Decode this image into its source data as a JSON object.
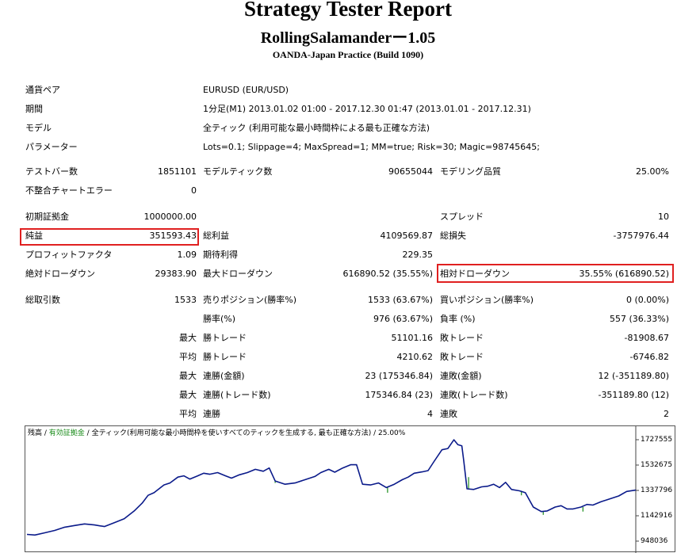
{
  "header": {
    "title": "Strategy Tester Report",
    "subtitle": "RollingSalamanderー1.05",
    "build": "OANDA-Japan Practice (Build 1090)"
  },
  "settings": {
    "symbol_label": "通貨ペア",
    "symbol_value": "EURUSD (EUR/USD)",
    "period_label": "期間",
    "period_value": "1分足(M1) 2013.01.02 01:00 - 2017.12.30 01:47 (2013.01.01 - 2017.12.31)",
    "model_label": "モデル",
    "model_value": "全ティック (利用可能な最小時間枠による最も正確な方法)",
    "params_label": "パラメーター",
    "params_value": "Lots=0.1; Slippage=4; MaxSpread=1; MM=true; Risk=30; Magic=98745645;"
  },
  "quality": {
    "bars_label": "テストバー数",
    "bars_value": "1851101",
    "ticks_label": "モデルティック数",
    "ticks_value": "90655044",
    "quality_label": "モデリング品質",
    "quality_value": "25.00%",
    "errors_label": "不整合チャートエラー",
    "errors_value": "0"
  },
  "results": {
    "deposit_label": "初期証拠金",
    "deposit_value": "1000000.00",
    "spread_label": "スプレッド",
    "spread_value": "10",
    "net_label": "純益",
    "net_value": "351593.43",
    "gross_profit_label": "総利益",
    "gross_profit_value": "4109569.87",
    "gross_loss_label": "総損失",
    "gross_loss_value": "-3757976.44",
    "pf_label": "プロフィットファクタ",
    "pf_value": "1.09",
    "expected_label": "期待利得",
    "expected_value": "229.35",
    "abs_dd_label": "絶対ドローダウン",
    "abs_dd_value": "29383.90",
    "max_dd_label": "最大ドローダウン",
    "max_dd_value": "616890.52 (35.55%)",
    "rel_dd_label": "相対ドローダウン",
    "rel_dd_value": "35.55% (616890.52)"
  },
  "trades": {
    "total_label": "総取引数",
    "total_value": "1533",
    "short_label": "売りポジション(勝率%)",
    "short_value": "1533 (63.67%)",
    "long_label": "買いポジション(勝率%)",
    "long_value": "0 (0.00%)",
    "win_label": "勝率(%)",
    "win_value": "976 (63.67%)",
    "loss_label": "負率 (%)",
    "loss_value": "557 (36.33%)",
    "largest_prefix": "最大",
    "largest_win_label": "勝トレード",
    "largest_win_value": "51101.16",
    "largest_loss_label": "敗トレード",
    "largest_loss_value": "-81908.67",
    "average_prefix": "平均",
    "average_win_label": "勝トレード",
    "average_win_value": "4210.62",
    "average_loss_label": "敗トレード",
    "average_loss_value": "-6746.82",
    "max_money_prefix": "最大",
    "max_consec_win_money_label": "連勝(金額)",
    "max_consec_win_money_value": "23 (175346.84)",
    "max_consec_loss_money_label": "連敗(金額)",
    "max_consec_loss_money_value": "12 (-351189.80)",
    "max_count_prefix": "最大",
    "max_consec_win_count_label": "連勝(トレード数)",
    "max_consec_win_count_value": "175346.84 (23)",
    "max_consec_loss_count_label": "連敗(トレード数)",
    "max_consec_loss_count_value": "-351189.80 (12)",
    "avg_consec_prefix": "平均",
    "avg_consec_win_label": "連勝",
    "avg_consec_win_value": "4",
    "avg_consec_loss_label": "連敗",
    "avg_consec_loss_value": "2"
  },
  "chart_data": {
    "type": "line",
    "legend": {
      "balance": "残高",
      "sep1": " / ",
      "equity": "有効証拠金",
      "sep2": " / ",
      "model": "全ティック(利用可能な最小時間枠を使いすべてのティックを生成する, 最も正確な方法)",
      "sep3": " / ",
      "quality": "25.00%"
    },
    "y_ticks": [
      "1727555",
      "1532675",
      "1337796",
      "1142916",
      "948036"
    ],
    "ylim": [
      948036,
      1727555
    ],
    "xlim": [
      0,
      1533
    ],
    "balance_color": "#0a1a8a",
    "equity_color": "#1a8c1a",
    "balance": [
      [
        0,
        1000000
      ],
      [
        20,
        995000
      ],
      [
        45,
        1012000
      ],
      [
        70,
        1030000
      ],
      [
        95,
        1055000
      ],
      [
        120,
        1068000
      ],
      [
        145,
        1080000
      ],
      [
        170,
        1072000
      ],
      [
        195,
        1060000
      ],
      [
        220,
        1090000
      ],
      [
        245,
        1120000
      ],
      [
        270,
        1180000
      ],
      [
        290,
        1240000
      ],
      [
        305,
        1300000
      ],
      [
        320,
        1320000
      ],
      [
        345,
        1380000
      ],
      [
        360,
        1395000
      ],
      [
        380,
        1440000
      ],
      [
        395,
        1450000
      ],
      [
        410,
        1425000
      ],
      [
        430,
        1450000
      ],
      [
        445,
        1470000
      ],
      [
        460,
        1462000
      ],
      [
        480,
        1475000
      ],
      [
        500,
        1450000
      ],
      [
        515,
        1432000
      ],
      [
        535,
        1458000
      ],
      [
        555,
        1475000
      ],
      [
        575,
        1500000
      ],
      [
        595,
        1485000
      ],
      [
        610,
        1510000
      ],
      [
        625,
        1410000
      ],
      [
        650,
        1385000
      ],
      [
        675,
        1395000
      ],
      [
        700,
        1420000
      ],
      [
        725,
        1445000
      ],
      [
        740,
        1475000
      ],
      [
        760,
        1500000
      ],
      [
        775,
        1478000
      ],
      [
        795,
        1510000
      ],
      [
        815,
        1535000
      ],
      [
        830,
        1535000
      ],
      [
        845,
        1385000
      ],
      [
        865,
        1380000
      ],
      [
        885,
        1395000
      ],
      [
        905,
        1360000
      ],
      [
        925,
        1385000
      ],
      [
        945,
        1420000
      ],
      [
        960,
        1440000
      ],
      [
        975,
        1470000
      ],
      [
        995,
        1480000
      ],
      [
        1010,
        1490000
      ],
      [
        1025,
        1560000
      ],
      [
        1045,
        1650000
      ],
      [
        1060,
        1660000
      ],
      [
        1075,
        1727000
      ],
      [
        1085,
        1690000
      ],
      [
        1095,
        1680000
      ],
      [
        1100,
        1560000
      ],
      [
        1108,
        1350000
      ],
      [
        1125,
        1345000
      ],
      [
        1145,
        1365000
      ],
      [
        1160,
        1370000
      ],
      [
        1175,
        1385000
      ],
      [
        1190,
        1360000
      ],
      [
        1205,
        1400000
      ],
      [
        1220,
        1345000
      ],
      [
        1240,
        1335000
      ],
      [
        1255,
        1320000
      ],
      [
        1275,
        1210000
      ],
      [
        1295,
        1175000
      ],
      [
        1310,
        1180000
      ],
      [
        1330,
        1210000
      ],
      [
        1345,
        1220000
      ],
      [
        1360,
        1195000
      ],
      [
        1375,
        1195000
      ],
      [
        1395,
        1210000
      ],
      [
        1410,
        1230000
      ],
      [
        1425,
        1225000
      ],
      [
        1445,
        1250000
      ],
      [
        1465,
        1270000
      ],
      [
        1490,
        1295000
      ],
      [
        1510,
        1330000
      ],
      [
        1533,
        1340000
      ]
    ],
    "equity_dips": [
      [
        625,
        1395000
      ],
      [
        908,
        1320000
      ],
      [
        1112,
        1440000
      ],
      [
        1245,
        1300000
      ],
      [
        1300,
        1150000
      ],
      [
        1400,
        1175000
      ]
    ]
  }
}
